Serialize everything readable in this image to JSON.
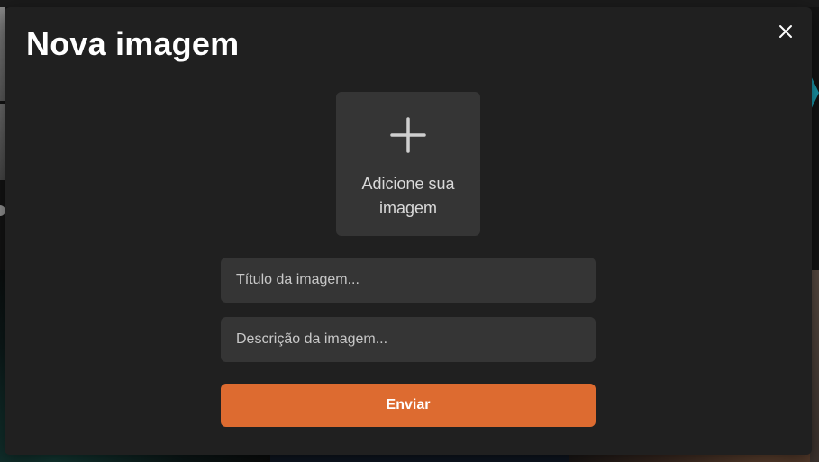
{
  "modal": {
    "title": "Nova imagem",
    "close_icon": "close-icon",
    "upload": {
      "icon": "plus-icon",
      "label": "Adicione sua imagem"
    },
    "title_field": {
      "value": "",
      "placeholder": "Título da imagem..."
    },
    "description_field": {
      "value": "",
      "placeholder": "Descrição da imagem..."
    },
    "submit_label": "Enviar"
  },
  "colors": {
    "modal_background": "#202020",
    "field_background": "#353535",
    "accent": "#DD6B30",
    "text": "#FFFFFF"
  }
}
